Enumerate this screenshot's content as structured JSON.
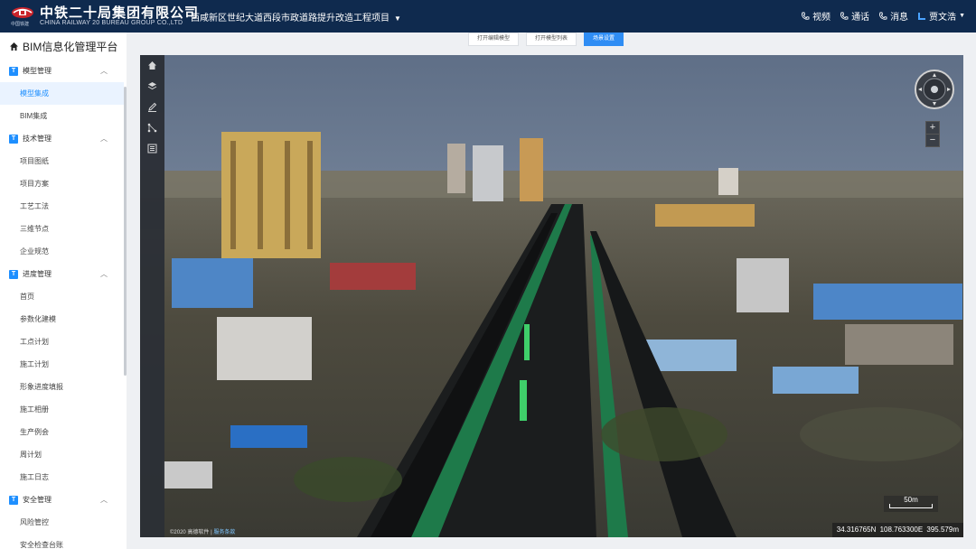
{
  "header": {
    "logo_small": "中国铁建",
    "brand_cn": "中铁二十局集团有限公司",
    "brand_en": "CHINA RAILWAY 20 BUREAU GROUP CO.,LTD",
    "project": "西咸新区世纪大道西段市政道路提升改造工程项目",
    "actions": [
      {
        "label": "视频",
        "icon": "phone-icon"
      },
      {
        "label": "通话",
        "icon": "phone-icon"
      },
      {
        "label": "消息",
        "icon": "phone-icon"
      }
    ],
    "user": "贾文浩"
  },
  "sidebar": {
    "title": "BIM信息化管理平台",
    "groups": [
      {
        "badge": "T",
        "label": "模型管理",
        "items": [
          "模型集成",
          "BIM集成"
        ]
      },
      {
        "badge": "T",
        "label": "技术管理",
        "items": [
          "项目图纸",
          "项目方案",
          "工艺工法",
          "三维节点",
          "企业规范"
        ]
      },
      {
        "badge": "T",
        "label": "进度管理",
        "items": [
          "首页",
          "参数化建模",
          "工点计划",
          "施工计划",
          "形象进度填报",
          "施工相册",
          "生产例会",
          "周计划",
          "施工日志"
        ]
      },
      {
        "badge": "T",
        "label": "安全管理",
        "items": [
          "风险管控",
          "安全检查台账"
        ]
      }
    ],
    "active_item": "模型集成"
  },
  "tabs": [
    "打开编辑模型",
    "打开模型列表",
    "场景设置"
  ],
  "active_tab": "场景设置",
  "viewer": {
    "tools": [
      "home-icon",
      "layers-icon",
      "pencil-icon",
      "measure-icon",
      "list-icon"
    ],
    "zoom_in": "+",
    "zoom_out": "−",
    "scale": "50m",
    "coordinates": "34.316765N  108.763300E  395.579m",
    "copyright": "©2020 高德软件",
    "service_link": "服务条款"
  }
}
